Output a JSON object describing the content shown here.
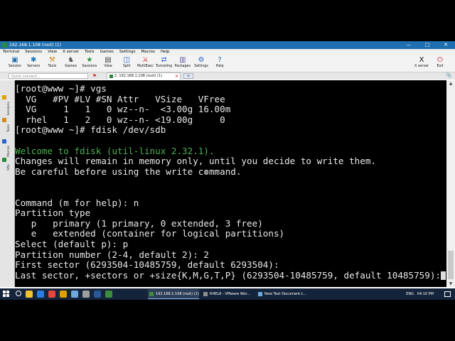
{
  "window": {
    "title": "192.168.1.108 (root) (1)"
  },
  "menu": [
    "Terminal",
    "Sessions",
    "View",
    "X server",
    "Tools",
    "Games",
    "Settings",
    "Macros",
    "Help"
  ],
  "toolbar": {
    "left": [
      {
        "label": "Session",
        "icon": "session-icon",
        "glyph": "▣",
        "color": "#1f6fb0"
      },
      {
        "label": "Servers",
        "icon": "servers-icon",
        "glyph": "✱",
        "color": "#1f6fb0"
      },
      {
        "label": "Tools",
        "icon": "tools-icon",
        "glyph": "⚒",
        "color": "#d08a1a"
      },
      {
        "label": "Games",
        "icon": "games-icon",
        "glyph": "♞",
        "color": "#555"
      },
      {
        "label": "Sessions",
        "icon": "sessions-icon",
        "glyph": "★",
        "color": "#2b8a3e"
      },
      {
        "label": "View",
        "icon": "view-icon",
        "glyph": "▤",
        "color": "#444"
      },
      {
        "label": "Split",
        "icon": "split-icon",
        "glyph": "◫",
        "color": "#2a63c9"
      },
      {
        "label": "MultiExec",
        "icon": "multiexec-icon",
        "glyph": "⚔",
        "color": "#c9302c"
      },
      {
        "label": "Tunneling",
        "icon": "tunneling-icon",
        "glyph": "⮂",
        "color": "#2a63c9"
      },
      {
        "label": "Packages",
        "icon": "packages-icon",
        "glyph": "▥",
        "color": "#6b5ba8"
      },
      {
        "label": "Settings",
        "icon": "settings-icon",
        "glyph": "⚙",
        "color": "#2a63c9"
      },
      {
        "label": "Help",
        "icon": "help-icon",
        "glyph": "?",
        "color": "#1f6fb0"
      }
    ],
    "right": [
      {
        "label": "X server",
        "icon": "xserver-icon",
        "glyph": "X",
        "color": "#111"
      },
      {
        "label": "Exit",
        "icon": "exit-icon",
        "glyph": "⏻",
        "color": "#d32f2f"
      }
    ]
  },
  "quick_connect": {
    "placeholder": "Quick connect..."
  },
  "session_tab": {
    "label": "2. 192.168.1.108 (root) (1)"
  },
  "sidebar": [
    {
      "label": "Sessions",
      "icon": "sessions-side-icon",
      "color": "#e0a100"
    },
    {
      "label": "Tools",
      "icon": "tools-side-icon",
      "color": "#d08a1a"
    },
    {
      "label": "Macros",
      "icon": "macros-side-icon",
      "color": "#2a63c9"
    },
    {
      "label": "Sftp",
      "icon": "sftp-side-icon",
      "color": "#2b8a3e"
    }
  ],
  "terminal": {
    "lines": [
      {
        "text": "[root@www ~]# vgs",
        "style": "normal"
      },
      {
        "text": "  VG   #PV #LV #SN Attr   VSize   VFree",
        "style": "normal"
      },
      {
        "text": "  VG     1   1   0 wz--n-  <3.00g 16.00m",
        "style": "normal"
      },
      {
        "text": "  rhel   1   2   0 wz--n- <19.00g     0",
        "style": "normal"
      },
      {
        "text": "[root@www ~]# fdisk /dev/sdb",
        "style": "normal"
      },
      {
        "text": "",
        "style": "normal"
      },
      {
        "text": "Welcome to fdisk (util-linux 2.32.1).",
        "style": "green"
      },
      {
        "text": "Changes will remain in memory only, until you decide to write them.",
        "style": "normal"
      },
      {
        "text": "Be careful before using the write command.",
        "style": "normal"
      },
      {
        "text": "",
        "style": "normal"
      },
      {
        "text": "",
        "style": "normal"
      },
      {
        "text": "Command (m for help): n",
        "style": "normal"
      },
      {
        "text": "Partition type",
        "style": "normal"
      },
      {
        "text": "   p   primary (1 primary, 0 extended, 3 free)",
        "style": "normal"
      },
      {
        "text": "   e   extended (container for logical partitions)",
        "style": "normal"
      },
      {
        "text": "Select (default p): p",
        "style": "normal"
      },
      {
        "text": "Partition number (2-4, default 2): 2",
        "style": "normal"
      },
      {
        "text": "First sector (6293504-10485759, default 6293504):",
        "style": "normal"
      },
      {
        "text": "Last sector, +sectors or +size{K,M,G,T,P} (6293504-10485759, default 10485759):",
        "style": "cursor"
      }
    ]
  },
  "taskbar": {
    "pinned": [
      {
        "icon": "file-explorer-icon",
        "color": "#f2c12e"
      },
      {
        "icon": "edge-icon",
        "color": "#2a7de1"
      },
      {
        "icon": "chrome-icon",
        "color": "#e8453c"
      },
      {
        "icon": "folder-icon",
        "color": "#e0a100"
      },
      {
        "icon": "store-icon",
        "color": "#6fa8dc"
      },
      {
        "icon": "settings-app-icon",
        "color": "#9e9e9e"
      },
      {
        "icon": "word-icon",
        "color": "#2b579a"
      },
      {
        "icon": "mobaxterm-icon",
        "color": "#3c8c3c"
      }
    ],
    "tasks": [
      {
        "label": "192.168.1.108 (root) (1)",
        "icon": "terminal-task-icon",
        "color": "#3c8c3c",
        "active": true
      },
      {
        "label": "RHEL8 - VMware Wor...",
        "icon": "vmware-task-icon",
        "color": "#8e8e8e",
        "active": false
      },
      {
        "label": "New Text Document.t...",
        "icon": "notepad-task-icon",
        "color": "#6fa8dc",
        "active": false
      }
    ],
    "tray": {
      "language": "ENG",
      "time": "04:10 PM"
    }
  },
  "colors": {
    "title_bar": "#1f6fb0",
    "terminal_bg": "#000000",
    "terminal_fg": "#e8e8e8",
    "terminal_green": "#4caf50",
    "taskbar": "#14243a"
  }
}
